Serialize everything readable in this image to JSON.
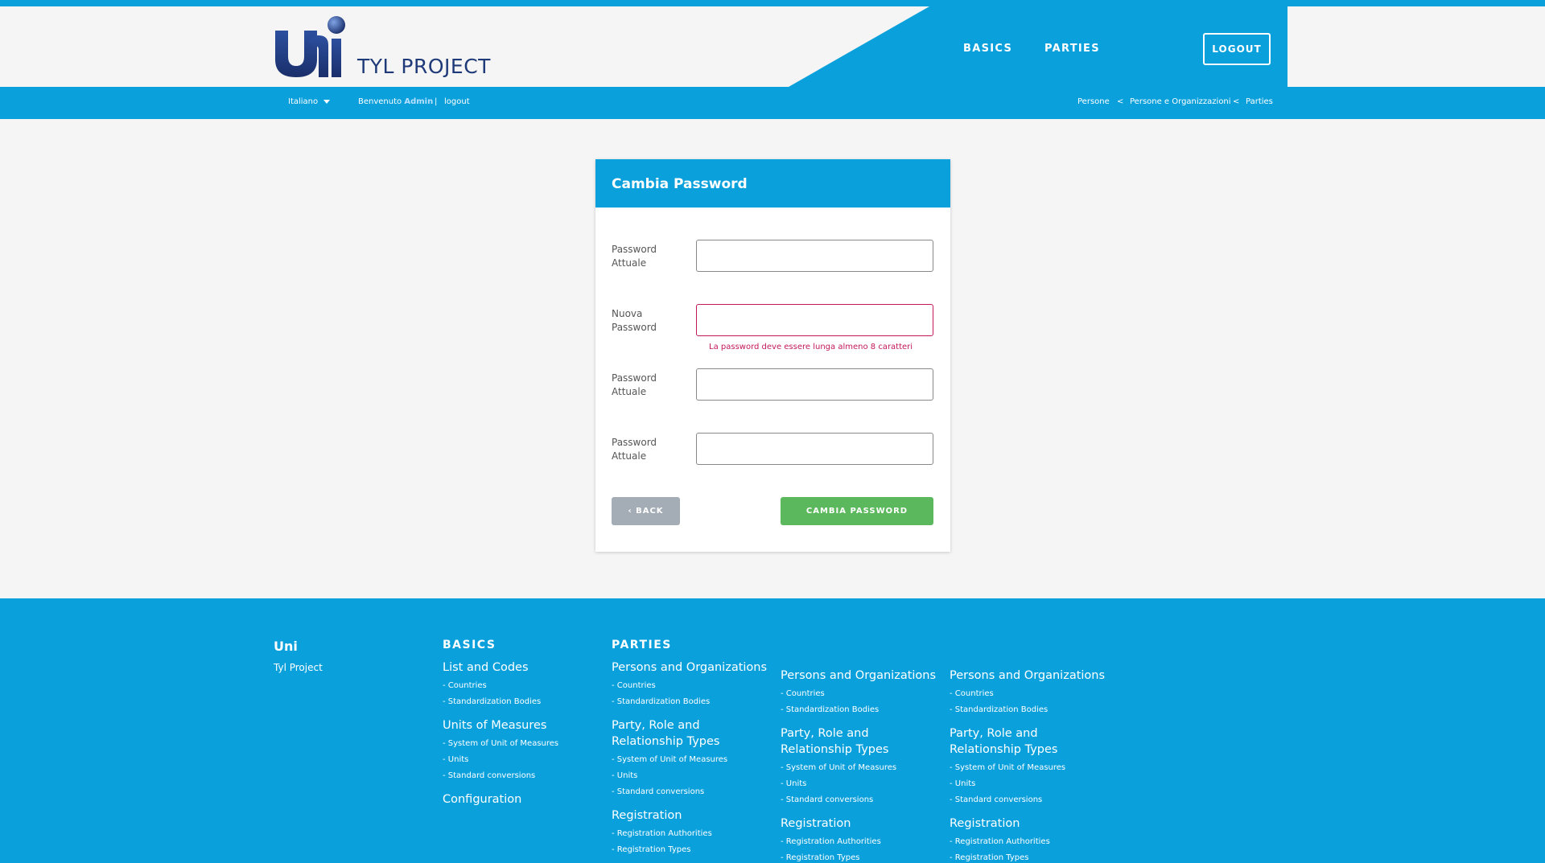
{
  "header": {
    "brand": "TYL PROJECT",
    "nav": [
      "BASICS",
      "PARTIES"
    ],
    "logout_button": "LOGOUT"
  },
  "subbar": {
    "language": "Italiano",
    "welcome": "Benvenuto",
    "user": "Admin",
    "separator": "|",
    "logout_link": "logout",
    "breadcrumb": [
      "Persone",
      "Persone e Organizzazioni",
      "Parties"
    ],
    "breadcrumb_sep": "<"
  },
  "form": {
    "title": "Cambia Password",
    "fields": [
      {
        "label": "Password Attuale",
        "value": ""
      },
      {
        "label": "Nuova Password",
        "value": "",
        "error": "La password deve essere lunga almeno 8 caratteri"
      },
      {
        "label": "Password Attuale",
        "value": ""
      },
      {
        "label": "Password Attuale",
        "value": ""
      }
    ],
    "back_button": "BACK",
    "submit_button": "CAMBIA PASSWORD"
  },
  "footer": {
    "brand": "Uni",
    "brand_sub": "Tyl Project",
    "basics": {
      "title": "BASICS",
      "sections": [
        {
          "heading": "List and Codes",
          "links": [
            "- Countries",
            "- Standardization Bodies"
          ]
        },
        {
          "heading": "Units of Measures",
          "links": [
            "- System of Unit of Measures",
            "- Units",
            "- Standard conversions"
          ]
        },
        {
          "heading": "Configuration",
          "links": []
        }
      ]
    },
    "parties": {
      "title": "PARTIES",
      "columns": [
        {
          "sections": [
            {
              "heading": "Persons and Organizations",
              "links": [
                "- Countries",
                "- Standardization Bodies"
              ]
            },
            {
              "heading": "Party, Role and Relationship Types",
              "links": [
                "- System of Unit of Measures",
                "- Units",
                "- Standard conversions"
              ]
            },
            {
              "heading": "Registration",
              "links": [
                "- Registration Authorities",
                "- Registration Types"
              ]
            }
          ]
        },
        {
          "sections": [
            {
              "heading": "Persons and Organizations",
              "links": [
                "- Countries",
                "- Standardization Bodies"
              ]
            },
            {
              "heading": "Party, Role and Relationship Types",
              "links": [
                "- System of Unit of Measures",
                "- Units",
                "- Standard conversions"
              ]
            },
            {
              "heading": "Registration",
              "links": [
                "- Registration Authorities",
                "- Registration Types"
              ]
            }
          ]
        },
        {
          "sections": [
            {
              "heading": "Persons and Organizations",
              "links": [
                "- Countries",
                "- Standardization Bodies"
              ]
            },
            {
              "heading": "Party, Role and Relationship Types",
              "links": [
                "- System of Unit of Measures",
                "- Units",
                "- Standard conversions"
              ]
            },
            {
              "heading": "Registration",
              "links": [
                "- Registration Authorities",
                "- Registration Types"
              ]
            }
          ]
        }
      ]
    }
  }
}
